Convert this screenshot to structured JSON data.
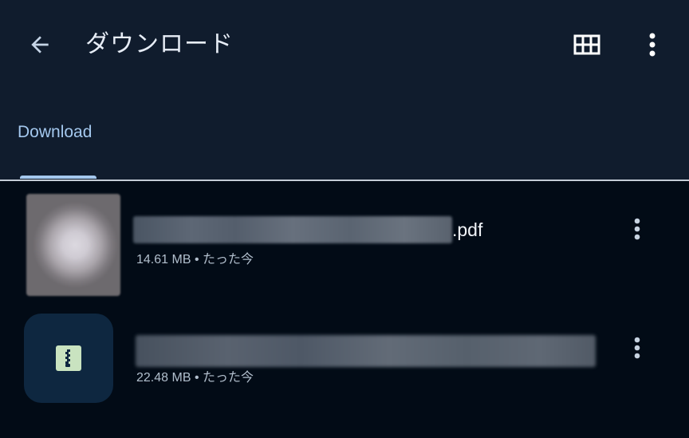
{
  "header": {
    "title": "ダウンロード",
    "back_icon": "arrow-back-icon",
    "view_toggle_icon": "grid-view-icon",
    "more_icon": "more-vert-icon"
  },
  "tabs": [
    {
      "label": "Download",
      "selected": true
    }
  ],
  "files": [
    {
      "name_visible_suffix": ".pdf",
      "name_blurred": true,
      "size": "14.61 MB",
      "separator": "•",
      "time": "たった今",
      "thumbnail": "pdf-thumbnail-blurred",
      "more_icon": "more-vert-icon"
    },
    {
      "name_visible_suffix": "",
      "name_blurred": true,
      "size": "22.48 MB",
      "separator": "•",
      "time": "たった今",
      "thumbnail": "zip-file-icon",
      "more_icon": "more-vert-icon"
    }
  ],
  "colors": {
    "background": "#020b16",
    "header_background": "#101c2d",
    "accent": "#a4c8ee",
    "zip_tile": "#0e2740",
    "zip_icon": "#c9e3c0"
  }
}
